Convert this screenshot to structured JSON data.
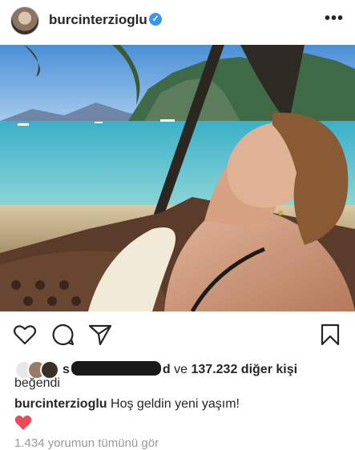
{
  "post": {
    "username": "burcinterzioglu",
    "verified_icon": "verified-badge-icon",
    "more_icon": "ellipsis-icon",
    "more_label": "•••"
  },
  "actions": {
    "like_icon": "heart-outline-icon",
    "comment_icon": "comment-bubble-icon",
    "share_icon": "paper-plane-icon",
    "save_icon": "bookmark-icon"
  },
  "likes": {
    "prefix": "s",
    "suffix_letter": "d",
    "connector": "ve",
    "count": "137.232",
    "others_label": "diğer kişi",
    "liked_label": "beğendi"
  },
  "caption": {
    "username": "burcinterzioglu",
    "text": "Hoş geldin yeni yaşım!",
    "emoji": "red-heart-emoji"
  },
  "comments": {
    "link_text": "1.434 yorumun tümünü gör"
  },
  "colors": {
    "verified": "#3897f0",
    "text": "#262626",
    "muted": "#999999",
    "heart": "#ed4956"
  }
}
